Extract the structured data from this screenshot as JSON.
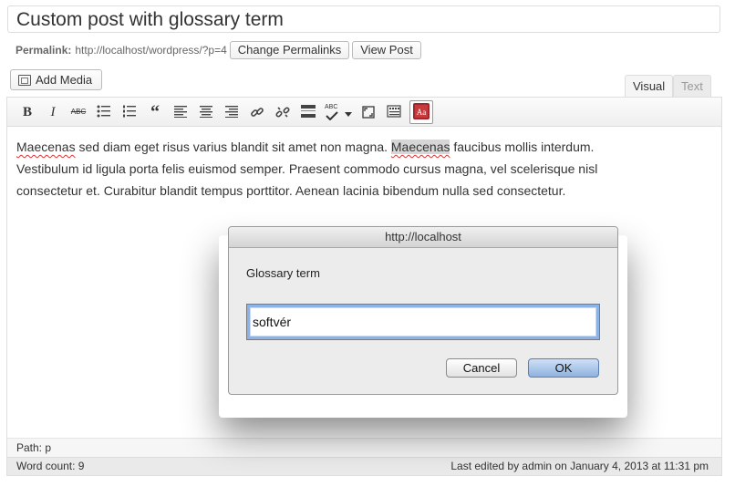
{
  "post": {
    "title": "Custom post with glossary term",
    "permalink_label": "Permalink:",
    "permalink_url": "http://localhost/wordpress/?p=4",
    "change_permalinks": "Change Permalinks",
    "view_post": "View Post"
  },
  "editor": {
    "add_media": "Add Media",
    "tabs": {
      "visual": "Visual",
      "text": "Text"
    },
    "toolbar": {
      "bold": "B",
      "italic": "I",
      "strike": "ABC",
      "quote": "“",
      "spell": "ABC"
    },
    "content": {
      "w1": "Maecenas",
      "t1": " sed diam eget risus varius blandit sit amet non magna. ",
      "w2": "Maecenas",
      "t2": " faucibus mollis interdum. Vestibulum id ligula porta felis euismod semper. Praesent commodo cursus magna, vel scelerisque nisl consectetur et. Curabitur blandit tempus porttitor. Aenean lacinia bibendum nulla sed consectetur."
    },
    "path": "Path: p",
    "word_count": "Word count: 9",
    "last_edited": "Last edited by admin on January 4, 2013 at 11:31 pm"
  },
  "dialog": {
    "title": "http://localhost",
    "label": "Glossary term",
    "input_value": "softvér",
    "cancel": "Cancel",
    "ok": "OK"
  }
}
